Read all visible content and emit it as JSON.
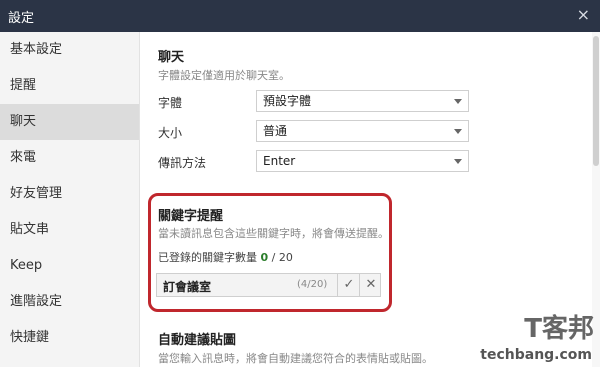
{
  "window": {
    "title": "設定",
    "close_label": "×"
  },
  "sidebar": {
    "items": [
      {
        "label": "基本設定"
      },
      {
        "label": "提醒"
      },
      {
        "label": "聊天"
      },
      {
        "label": "來電"
      },
      {
        "label": "好友管理"
      },
      {
        "label": "貼文串"
      },
      {
        "label": "Keep"
      },
      {
        "label": "進階設定"
      },
      {
        "label": "快捷鍵"
      }
    ]
  },
  "chat": {
    "title": "聊天",
    "description": "字體設定僅適用於聊天室。",
    "font_label": "字體",
    "font_value": "預設字體",
    "size_label": "大小",
    "size_value": "普通",
    "send_label": "傳訊方法",
    "send_value": "Enter"
  },
  "keyword": {
    "title": "關鍵字提醒",
    "description": "當未讀訊息包含這些關鍵字時，將會傳送提醒。",
    "count_label": "已登錄的關鍵字數量",
    "count_value": "0",
    "count_max": "/ 20",
    "input_value": "訂會議室",
    "input_counter": "(4/20)",
    "confirm_icon": "✓",
    "cancel_icon": "✕"
  },
  "auto_sticker": {
    "title": "自動建議貼圖",
    "description": "當您輸入訊息時，將會自動建議您符合的表情貼或貼圖。"
  },
  "watermark": {
    "line1": "T客邦",
    "line2": "techbang.com"
  },
  "colors": {
    "titlebar": "#2b3446",
    "highlight_border": "#c0272d",
    "count_green": "#2a7d2a"
  }
}
